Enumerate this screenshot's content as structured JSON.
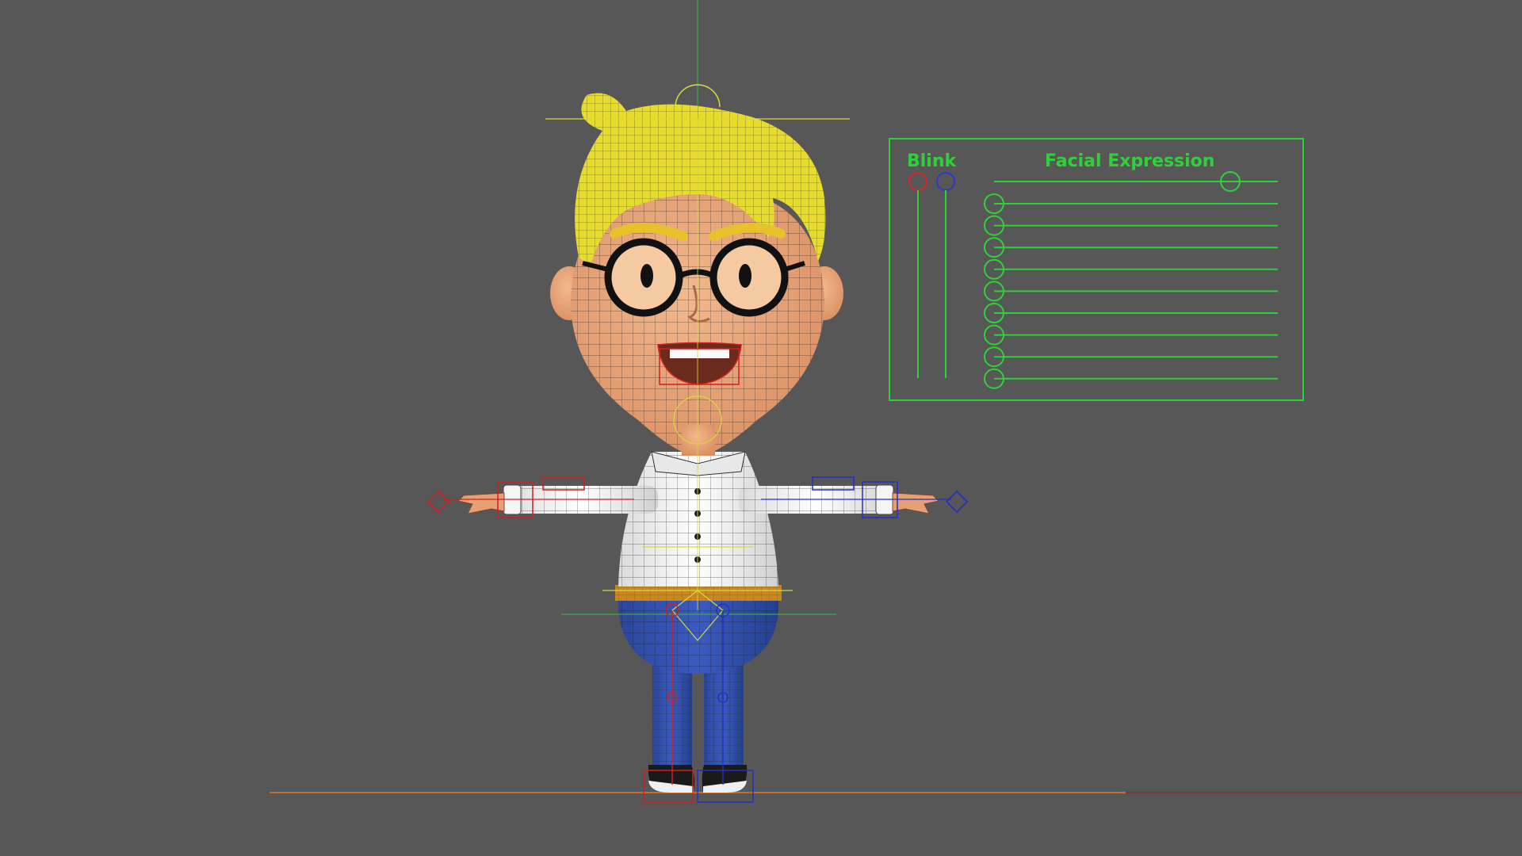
{
  "viewport": {
    "background": "#575757"
  },
  "control_panel": {
    "blink_label": "Blink",
    "facial_expression_label": "Facial Expression",
    "color": "#2fd03a",
    "blink_left_color": "#d8262b",
    "blink_right_color": "#2a39c8",
    "expression_slider_count": 9
  },
  "character": {
    "hair_color": "#e7dc2a",
    "skin_color": "#e8a577",
    "shirt_color": "#f2f2f2",
    "belt_color": "#c9871d",
    "pants_color": "#2c4aa6"
  },
  "rig": {
    "left_side_color": "#d02020",
    "right_side_color": "#2330c0",
    "center_color": "#d8d93a",
    "ground_color": "#e07a2a"
  }
}
